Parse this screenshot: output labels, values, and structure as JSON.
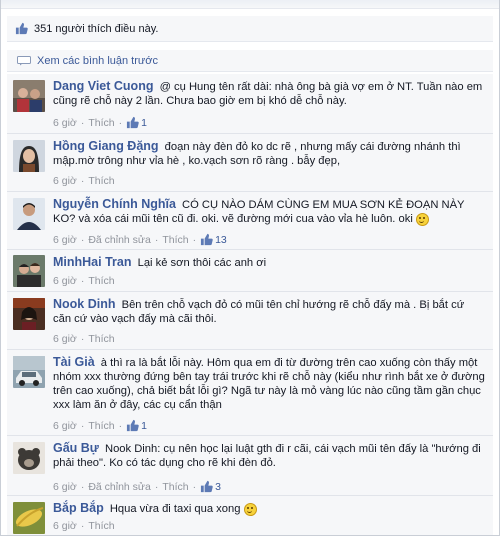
{
  "likes": {
    "text": "351 người thích điều này."
  },
  "view_previous": "Xem các bình luận trước",
  "comments": [
    {
      "author": "Dang Viet Cuong",
      "text": "@ cụ Hung tên rất dài: nhà ông bà già vợ em ở NT. Tuần nào em cũng rẽ chỗ này 2 lần. Chưa bao giờ em bị khó dễ chỗ này.",
      "time": "6 giờ",
      "like": "Thích",
      "like_count": "1",
      "edited": ""
    },
    {
      "author": "Hồng Giang Đặng",
      "text": "đoạn này đèn đỏ ko dc rẽ , nhưng mấy cái đường nhánh thì mập.mờ trông như vỉa hè , ko.vạch sơn rõ ràng . bẫy đẹp,",
      "time": "6 giờ",
      "like": "Thích",
      "like_count": "",
      "edited": ""
    },
    {
      "author": "Nguyễn Chính Nghĩa",
      "text": "CÓ CỤ NÀO DÁM CÙNG EM MUA SƠN KẺ ĐOẠN NÀY KO? và xóa cái mũi tên cũ đi. oki. vẽ đường mới cua vào vỉa hè luôn. oki",
      "time": "6 giờ",
      "like": "Thích",
      "like_count": "13",
      "edited": "Đã chỉnh sửa"
    },
    {
      "author": "MinhHai Tran",
      "text": "Lại kẻ sơn thôi các anh ơi",
      "time": "6 giờ",
      "like": "Thích",
      "like_count": "",
      "edited": ""
    },
    {
      "author": "Nook Dinh",
      "text": "Bên trên chỗ vạch đỏ có mũi tên chỉ hướng rẽ chỗ đấy mà . Bị bắt cứ căn cứ vào vạch đấy mà cãi thôi.",
      "time": "6 giờ",
      "like": "Thích",
      "like_count": "",
      "edited": ""
    },
    {
      "author": "Tài Già",
      "text": "à thì ra là bắt lỗi này. Hôm qua em đi từ đường trên cao xuống còn thấy một nhóm xxx thường đứng bên tay trái trước khi rẽ chỗ này (kiểu như rình bắt xe ở đường trên cao xuống), chả biết bắt lỗi gì? Ngã tư này là mỏ vàng lúc nào cũng tầm gần chục xxx làm ăn ở đây, các cụ cẩn thận",
      "time": "6 giờ",
      "like": "Thích",
      "like_count": "1",
      "edited": ""
    },
    {
      "author": "Gấu Bự",
      "text": "Nook Dinh: cụ nên học lại luật gth đi r cãi, cái vạch mũi tên đấy là \"hướng đi phải theo\". Ko có tác dụng cho rẽ khi đèn đỏ.",
      "time": "6 giờ",
      "like": "Thích",
      "like_count": "3",
      "edited": "Đã chỉnh sửa"
    },
    {
      "author": "Bắp Bắp",
      "text": "Hqua vừa đi taxi qua xong",
      "time": "6 giờ",
      "like": "Thích",
      "like_count": "",
      "edited": ""
    }
  ],
  "colors": {
    "link": "#3b5998",
    "meta": "#90949c",
    "row_bg": "#f6f7f9"
  },
  "icons": {
    "like": "thumbs-up-icon",
    "comment": "comment-bubble-icon",
    "emoji": "smiley-icon"
  }
}
